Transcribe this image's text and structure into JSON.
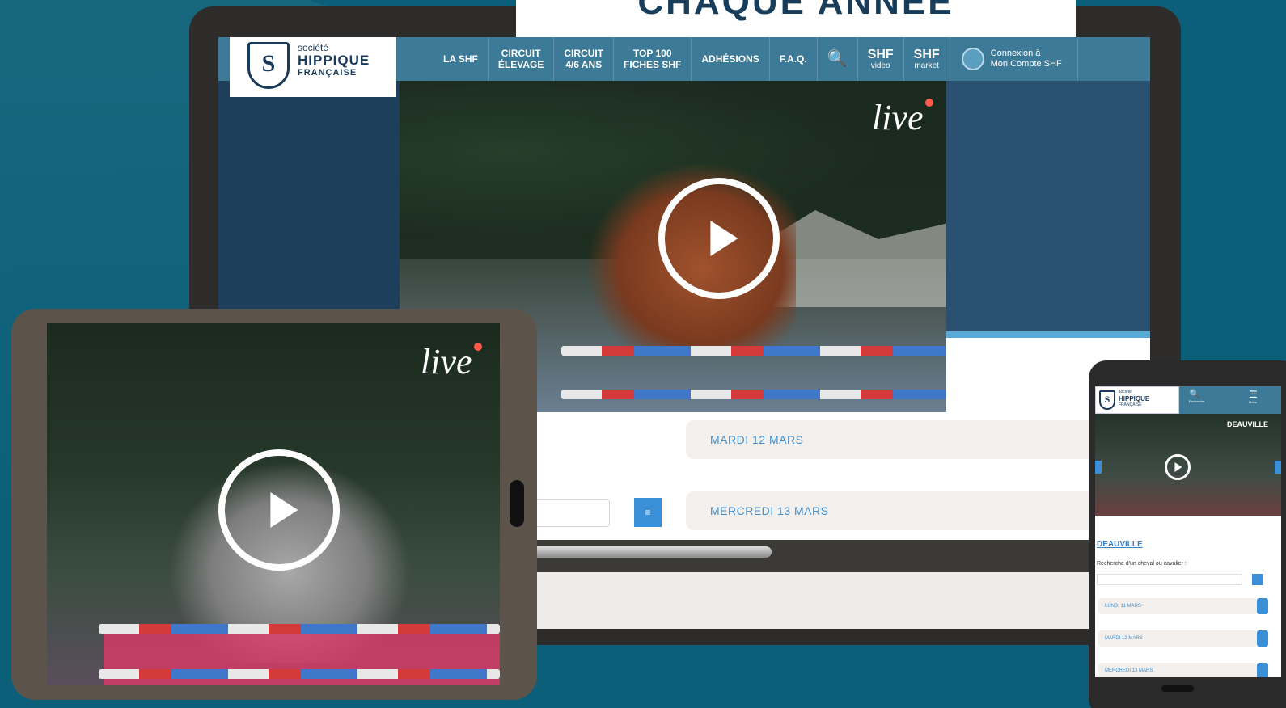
{
  "headline": "CHAQUE ANNÉE",
  "logo": {
    "line1": "société",
    "line2": "HIPPIQUE",
    "line3": "FRANÇAISE",
    "monogram": "S"
  },
  "nav": {
    "items": [
      {
        "label": "LA SHF"
      },
      {
        "label": "CIRCUIT\nÉLEVAGE"
      },
      {
        "label": "CIRCUIT\n4/6 ANS"
      },
      {
        "label": "TOP 100\nFICHES SHF"
      },
      {
        "label": "ADHÉSIONS"
      },
      {
        "label": "F.A.Q."
      }
    ],
    "search_icon": "🔍",
    "video": {
      "top": "SHF",
      "bottom": "video"
    },
    "market": {
      "top": "SHF",
      "bottom": "market"
    },
    "connexion": "Connexion à\nMon Compte SHF"
  },
  "live_label": "live",
  "dates": {
    "row1": "MARDI 12 MARS",
    "row2": "MERCREDI 13 MARS"
  },
  "search_button_icon": "≡",
  "phone": {
    "logo_line1": "société",
    "logo_line2": "HIPPIQUE",
    "logo_line3": "FRANÇAISE",
    "search_label": "Recherche",
    "menu_label": "Menu",
    "video_title": "DEAUVILLE",
    "link": "DEAUVILLE",
    "search_label_text": "Recherche d'un cheval ou cavalier :",
    "dates": [
      "LUNDI 11 MARS",
      "MARDI 12 MARS",
      "MERCREDI 13 MARS"
    ]
  },
  "colors": {
    "background": "#0b5f78",
    "nav": "#3c7a98",
    "accent": "#3a8fd6",
    "date_text": "#3f8fd0",
    "live_dot": "#ff5a4a"
  }
}
